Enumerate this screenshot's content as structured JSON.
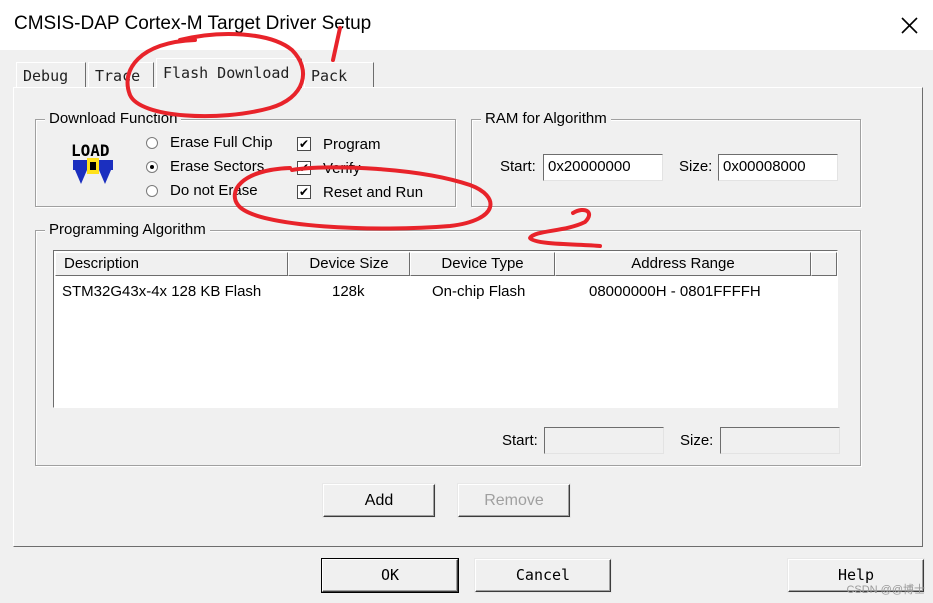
{
  "window": {
    "title": "CMSIS-DAP Cortex-M Target Driver Setup",
    "close_glyph": "✕"
  },
  "tabs": [
    {
      "label": "Debug",
      "active": false
    },
    {
      "label": "Trace",
      "active": false
    },
    {
      "label": "Flash Download",
      "active": true
    },
    {
      "label": "Pack",
      "active": false
    }
  ],
  "download_function": {
    "group_label": "Download Function",
    "load_icon_text": "LOAD",
    "radios": [
      {
        "label": "Erase Full Chip",
        "checked": false
      },
      {
        "label": "Erase Sectors",
        "checked": true
      },
      {
        "label": "Do not Erase",
        "checked": false
      }
    ],
    "checkboxes": [
      {
        "label": "Program",
        "checked": true
      },
      {
        "label": "Verify",
        "checked": true
      },
      {
        "label": "Reset and Run",
        "checked": true
      }
    ],
    "check_glyph": "✔"
  },
  "ram_for_algorithm": {
    "group_label": "RAM for Algorithm",
    "start_label": "Start:",
    "start_value": "0x20000000",
    "size_label": "Size:",
    "size_value": "0x00008000"
  },
  "programming_algorithm": {
    "group_label": "Programming Algorithm",
    "columns": [
      "Description",
      "Device Size",
      "Device Type",
      "Address Range"
    ],
    "rows": [
      [
        "STM32G43x-4x 128 KB Flash",
        "128k",
        "On-chip Flash",
        "08000000H - 0801FFFFH"
      ]
    ],
    "start_label": "Start:",
    "start_value": "",
    "size_label": "Size:",
    "size_value": ""
  },
  "buttons": {
    "add": "Add",
    "remove": "Remove",
    "ok": "OK",
    "cancel": "Cancel",
    "help": "Help"
  },
  "watermark": "CSDN @@博士",
  "annotation_color": "#e8232a"
}
